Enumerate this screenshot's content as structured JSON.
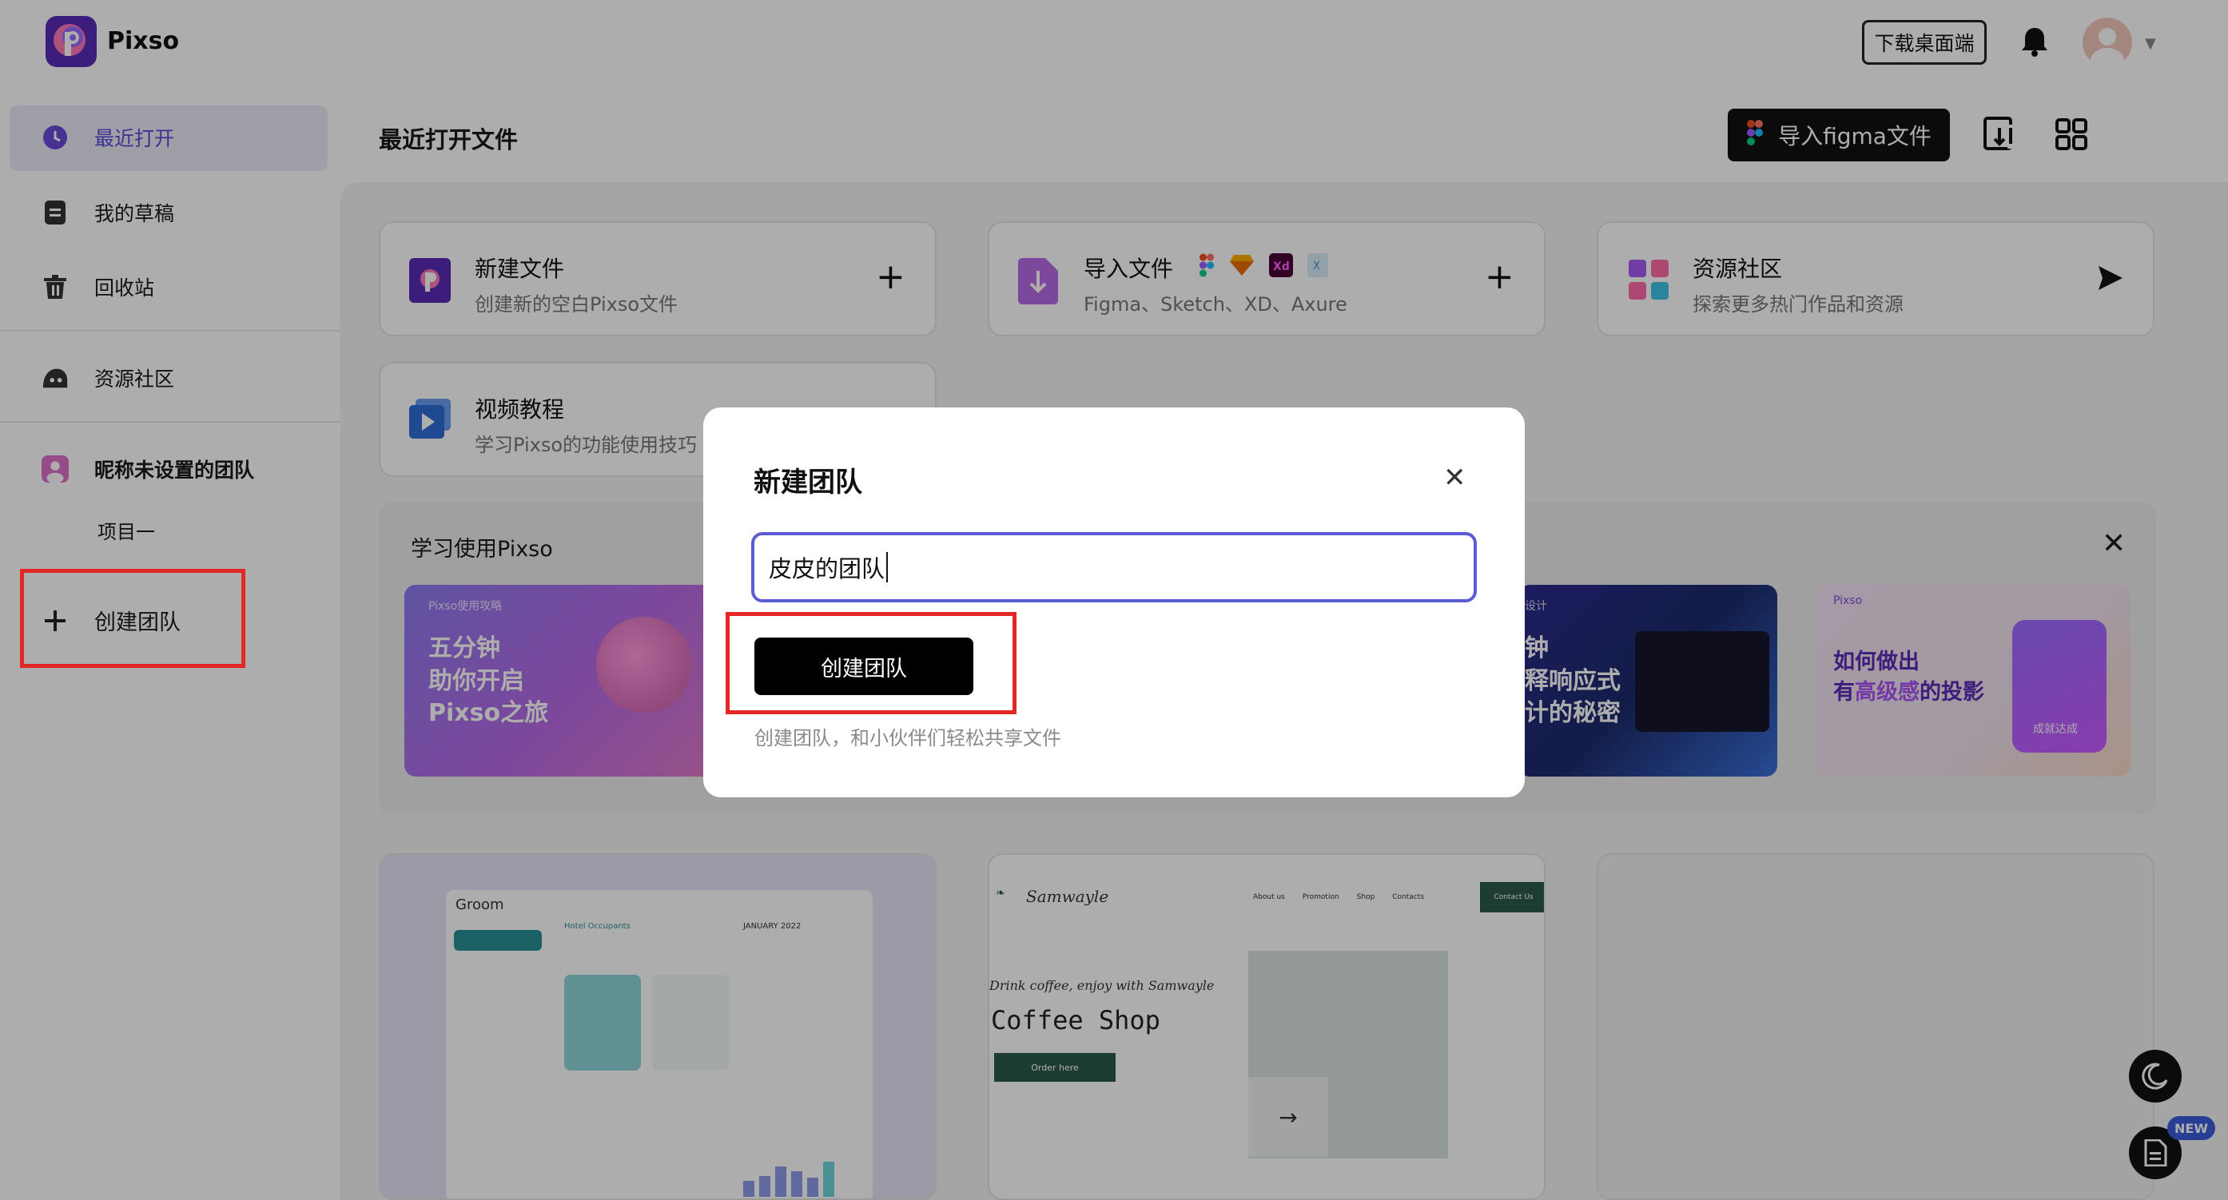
{
  "app": {
    "name": "Pixso"
  },
  "header": {
    "download_label": "下载桌面端"
  },
  "sidebar": {
    "items": [
      {
        "label": "最近打开"
      },
      {
        "label": "我的草稿"
      },
      {
        "label": "回收站"
      },
      {
        "label": "资源社区"
      }
    ],
    "team": {
      "name": "昵称未设置的团队",
      "project": "项目一"
    },
    "create_team": "创建团队"
  },
  "main": {
    "title": "最近打开文件",
    "import_figma": "导入figma文件",
    "cards": [
      {
        "title": "新建文件",
        "subtitle": "创建新的空白Pixso文件"
      },
      {
        "title": "导入文件",
        "subtitle": "Figma、Sketch、XD、Axure"
      },
      {
        "title": "资源社区",
        "subtitle": "探索更多热门作品和资源"
      },
      {
        "title": "视频教程",
        "subtitle": "学习Pixso的功能使用技巧"
      }
    ],
    "learn": {
      "title": "学习使用Pixso",
      "banners": [
        {
          "small": "Pixso使用攻略",
          "lines": [
            "五分钟",
            "助你开启",
            "Pixso之旅"
          ]
        },
        {
          "small": "设计",
          "lines": [
            "钟",
            "释响应式",
            "计的秘密"
          ]
        },
        {
          "small": "Pixso",
          "lines": [
            "如何做出",
            "有高级感的投影"
          ],
          "highlight": "高级感",
          "chip": "成就达成"
        }
      ]
    },
    "thumbs": [
      {
        "title": "Groom",
        "section": "Hotel Occupants",
        "calendar": "JANUARY 2022"
      },
      {
        "brand": "Samwayle",
        "nav": [
          "About us",
          "Promotion",
          "Shop",
          "Contacts",
          "Contact Us"
        ],
        "tagline": "Drink coffee, enjoy with Samwayle",
        "heading": "Coffee Shop",
        "cta": "Order here",
        "arrow": "→"
      }
    ]
  },
  "modal": {
    "title": "新建团队",
    "input_value": "皮皮的团队",
    "create_button": "创建团队",
    "hint": "创建团队，和小伙伴们轻松共享文件"
  },
  "fab": {
    "new_badge": "NEW"
  },
  "colors": {
    "accent": "#5b5bd6",
    "brand": "#5b2bb5",
    "highlight_box": "#e32626"
  }
}
